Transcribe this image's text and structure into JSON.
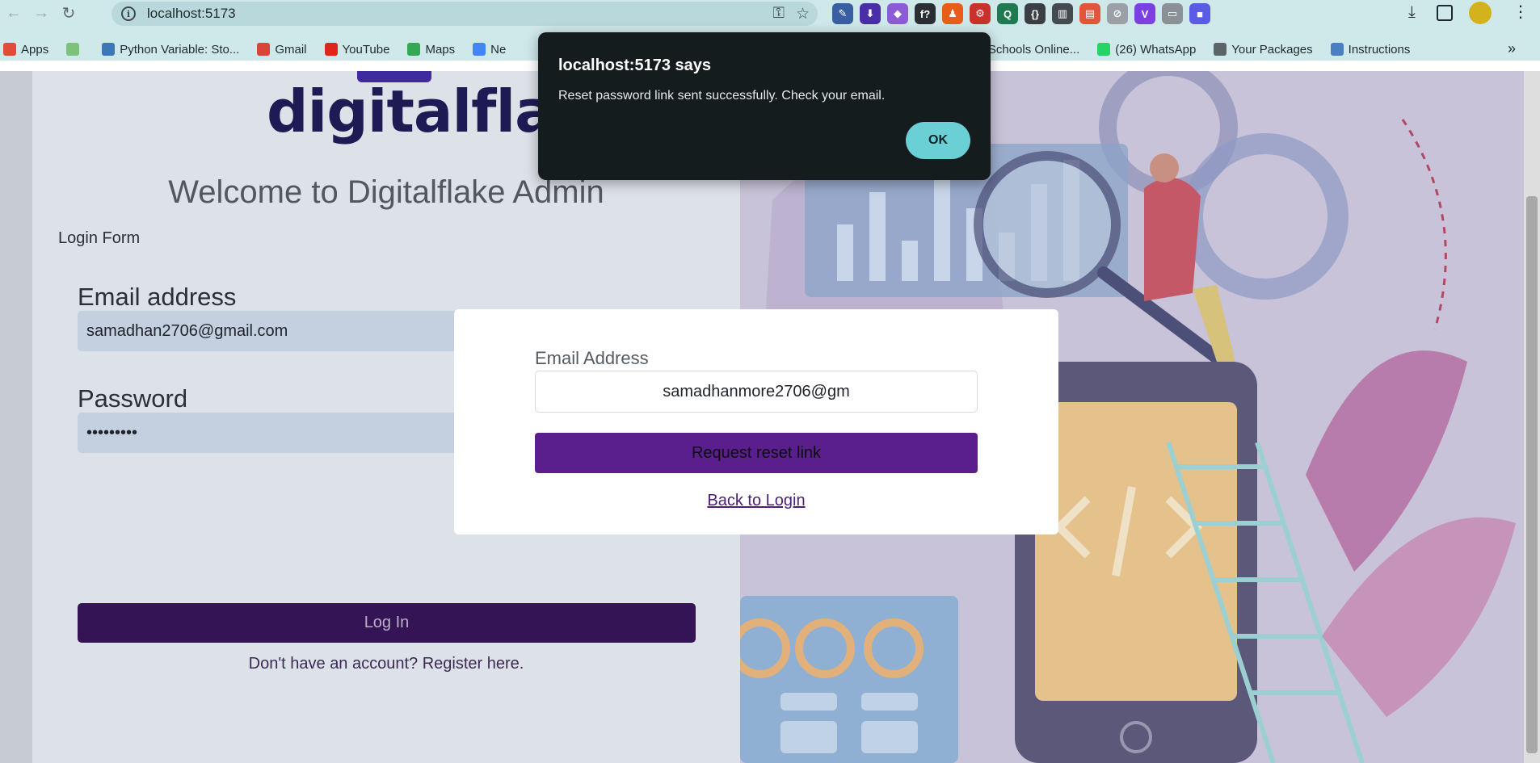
{
  "browser": {
    "url": "localhost:5173",
    "bookmarks": [
      {
        "label": "Apps",
        "color": "#e24a3b"
      },
      {
        "label": "",
        "color": "#7cc27a"
      },
      {
        "label": "Python Variable: Sto...",
        "color": "#3d77b5"
      },
      {
        "label": "Gmail",
        "color": "#d9453a"
      },
      {
        "label": "YouTube",
        "color": "#e0251b"
      },
      {
        "label": "Maps",
        "color": "#34a853"
      },
      {
        "label": "Ne",
        "color": "#4285f4"
      },
      {
        "label": "W3Schools Online...",
        "color": "#04aa6d"
      },
      {
        "label": "(26) WhatsApp",
        "color": "#25d366"
      },
      {
        "label": "Your Packages",
        "color": "#5b6466"
      },
      {
        "label": "Instructions",
        "color": "#4a7fc0"
      }
    ],
    "bookmarks_more": "»",
    "extensions": [
      {
        "glyph": "✎",
        "color": "#3a5fa0"
      },
      {
        "glyph": "⬇",
        "color": "#4a2ea8"
      },
      {
        "glyph": "◆",
        "color": "#8d5bd6"
      },
      {
        "glyph": "f?",
        "color": "#2b2f33"
      },
      {
        "glyph": "♟",
        "color": "#e85d1a"
      },
      {
        "glyph": "⚙",
        "color": "#c8322c"
      },
      {
        "glyph": "Q",
        "color": "#1f7a52"
      },
      {
        "glyph": "{}",
        "color": "#3b3f44"
      },
      {
        "glyph": "▥",
        "color": "#444a50"
      },
      {
        "glyph": "▤",
        "color": "#e2553b"
      },
      {
        "glyph": "⊘",
        "color": "#9aa0a6"
      },
      {
        "glyph": "V",
        "color": "#7b3fe4"
      },
      {
        "glyph": "▭",
        "color": "#8a9096"
      },
      {
        "glyph": "■",
        "color": "#5b5ce6"
      }
    ]
  },
  "login": {
    "brand": "digitalflake",
    "welcome": "Welcome to Digitalflake Admin",
    "form_caption": "Login Form",
    "email_label": "Email address",
    "email_value": "samadhan2706@gmail.com",
    "password_label": "Password",
    "password_value": "•••••••••",
    "login_button": "Log In",
    "register_text": "Don't have an account? Register here."
  },
  "modal": {
    "email_label": "Email Address",
    "email_value": "samadhanmore2706@gm",
    "submit_button": "Request reset link",
    "back_link": "Back to Login"
  },
  "alert": {
    "title": "localhost:5173 says",
    "message": "Reset password link sent successfully. Check your email.",
    "ok_button": "OK"
  },
  "colors": {
    "primary_purple": "#5a1f8c",
    "alert_ok": "#6bcfd6",
    "chrome": "#cfe8ea"
  }
}
